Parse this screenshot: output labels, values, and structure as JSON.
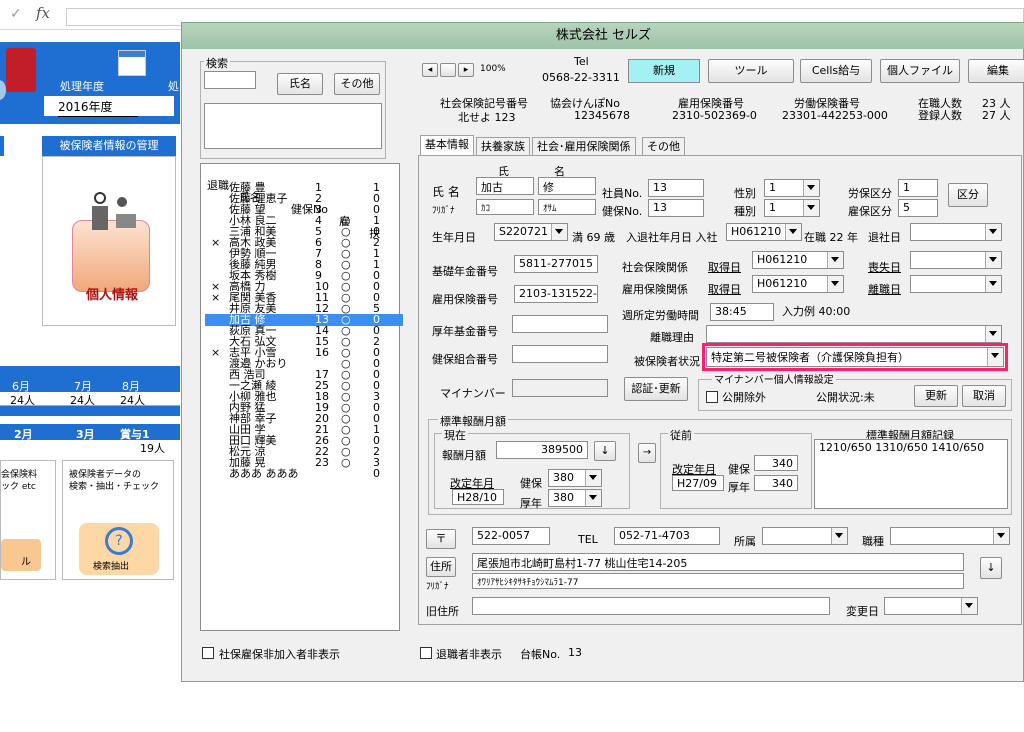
{
  "formula_bar": {
    "check": "✓",
    "fx": "fx"
  },
  "background": {
    "header_year_label": "処理年度",
    "header_year_label2": "処",
    "year": "2016年度",
    "insured_section": "被保険者情報の管理",
    "personal_info_btn": "個人情報",
    "month_headers": [
      "6月",
      "7月",
      "8月"
    ],
    "month_values": [
      "24人",
      "24人",
      "24人"
    ],
    "month2_headers": [
      "2月",
      "3月",
      "賞与1"
    ],
    "month2_values": [
      "",
      "",
      "19人"
    ],
    "box1_text": "会保険料\nック etc",
    "box2_text": "被保険者データの\n検索・抽出・チェック",
    "search_extract": "検索抽出",
    "box1_btn": "ル"
  },
  "window": {
    "title": "株式会社 セルズ"
  },
  "search": {
    "legend": "検索",
    "name_btn": "氏名",
    "other_btn": "その他"
  },
  "list": {
    "headers": [
      "退職",
      "氏名",
      "健保No",
      "雇",
      "扶"
    ],
    "rows": [
      {
        "ret": "",
        "name": "佐藤 豊",
        "no": "1",
        "emp": "",
        "dep": "1"
      },
      {
        "ret": "",
        "name": "佐藤 理恵子",
        "no": "2",
        "emp": "",
        "dep": "0"
      },
      {
        "ret": "",
        "name": "佐藤 望",
        "no": "3",
        "emp": "",
        "dep": "0"
      },
      {
        "ret": "",
        "name": "小林 良二",
        "no": "4",
        "emp": "○",
        "dep": "1"
      },
      {
        "ret": "",
        "name": "三浦 和美",
        "no": "5",
        "emp": "○",
        "dep": "0"
      },
      {
        "ret": "×",
        "name": "高木 政美",
        "no": "6",
        "emp": "○",
        "dep": "2"
      },
      {
        "ret": "",
        "name": "伊勢 順一",
        "no": "7",
        "emp": "○",
        "dep": "1"
      },
      {
        "ret": "",
        "name": "後藤 純男",
        "no": "8",
        "emp": "○",
        "dep": "1"
      },
      {
        "ret": "",
        "name": "坂本 秀樹",
        "no": "9",
        "emp": "○",
        "dep": "0"
      },
      {
        "ret": "×",
        "name": "高橋 力",
        "no": "10",
        "emp": "○",
        "dep": "0"
      },
      {
        "ret": "×",
        "name": "尾関 美香",
        "no": "11",
        "emp": "○",
        "dep": "0"
      },
      {
        "ret": "",
        "name": "井原 友美",
        "no": "12",
        "emp": "○",
        "dep": "5"
      },
      {
        "ret": "",
        "name": "加古 修",
        "no": "13",
        "emp": "○",
        "dep": "0"
      },
      {
        "ret": "",
        "name": "荻原 真一",
        "no": "14",
        "emp": "○",
        "dep": "0"
      },
      {
        "ret": "",
        "name": "大石 弘文",
        "no": "15",
        "emp": "○",
        "dep": "2"
      },
      {
        "ret": "×",
        "name": "志平 小雪",
        "no": "16",
        "emp": "○",
        "dep": "0"
      },
      {
        "ret": "",
        "name": "渡邉 かおり",
        "no": "",
        "emp": "○",
        "dep": "0"
      },
      {
        "ret": "",
        "name": "西 浩司",
        "no": "17",
        "emp": "○",
        "dep": "0"
      },
      {
        "ret": "",
        "name": "一之瀬 綾",
        "no": "25",
        "emp": "○",
        "dep": "0"
      },
      {
        "ret": "",
        "name": "小柳 雅也",
        "no": "18",
        "emp": "○",
        "dep": "3"
      },
      {
        "ret": "",
        "name": "内野 猛",
        "no": "19",
        "emp": "○",
        "dep": "0"
      },
      {
        "ret": "",
        "name": "神部 幸子",
        "no": "20",
        "emp": "○",
        "dep": "0"
      },
      {
        "ret": "",
        "name": "山田 学",
        "no": "21",
        "emp": "○",
        "dep": "1"
      },
      {
        "ret": "",
        "name": "田口 輝美",
        "no": "26",
        "emp": "○",
        "dep": "0"
      },
      {
        "ret": "",
        "name": "松元 涼",
        "no": "22",
        "emp": "○",
        "dep": "2"
      },
      {
        "ret": "",
        "name": "加藤 晃",
        "no": "23",
        "emp": "○",
        "dep": "3"
      },
      {
        "ret": "",
        "name": "あああ あああ",
        "no": "",
        "emp": "",
        "dep": "0"
      }
    ],
    "selected_index": 12,
    "hide_unenrolled": "社保雇保非加入者非表示"
  },
  "toolbar": {
    "zoom": "100%",
    "tel_label": "Tel",
    "tel_number": "0568-22-3311",
    "new_btn": "新規",
    "tool_btn": "ツール",
    "cells_btn": "Cells給与",
    "personal_file_btn": "個人ファイル",
    "edit_btn": "編集"
  },
  "company": {
    "ss_code_label": "社会保険記号番号",
    "ss_code": "北せよ 123",
    "kyokai_label": "協会けんぽNo",
    "kyokai_no": "12345678",
    "emp_ins_label": "雇用保険番号",
    "emp_ins_no": "2310-502369-0",
    "labor_label": "労働保険番号",
    "labor_no": "23301-442253-000",
    "enrolled_label": "在職人数",
    "enrolled_value": "23 人",
    "registered_label": "登録人数",
    "registered_value": "27 人"
  },
  "tabs": [
    "基本情報",
    "扶養家族",
    "社会･雇用保険関係",
    "その他"
  ],
  "basic": {
    "family_label": "氏",
    "given_label": "名",
    "name_label": "氏 名",
    "family": "加古",
    "given": "修",
    "kana_label": "ﾌﾘｶﾞﾅ",
    "family_kana": "ｶｺ",
    "given_kana": "ｵｻﾑ",
    "emp_no_label": "社員No.",
    "emp_no": "13",
    "kenpo_no_label": "健保No.",
    "kenpo_no": "13",
    "sex_label": "性別",
    "sex": "1",
    "kind_label": "種別",
    "kind": "1",
    "labor_cat_label": "労保区分",
    "labor_cat": "1",
    "emp_cat_label": "雇保区分",
    "emp_cat": "5",
    "kubun_btn": "区分",
    "birth_label": "生年月日",
    "birth": "S220721",
    "age": "満 69 歳",
    "join_label": "入退社年月日 入社",
    "join": "H061210",
    "tenure": "在職 22 年",
    "leave_label": "退社日",
    "leave": "",
    "pension_label": "基礎年金番号",
    "pension": "5811-277015",
    "ss_rel_label": "社会保険関係",
    "acquired_label": "取得日",
    "acquired": "H061210",
    "lost_label": "喪失日",
    "lost": "",
    "emp_ins_num_label": "雇用保険番号",
    "emp_ins_num": "2103-131522-5",
    "emp_rel_label": "雇用保険関係",
    "emp_acquired_label": "取得日",
    "emp_acquired": "H061210",
    "resign_label": "離職日",
    "resign": "",
    "hours_label": "週所定労働時間",
    "hours": "38:45",
    "hours_example": "入力例 40:00",
    "fund_label": "厚年基金番号",
    "fund": "",
    "reason_label": "離職理由",
    "reason": "",
    "union_label": "健保組合番号",
    "union": "",
    "status_label": "被保険者状況",
    "status": "特定第二号被保険者（介護保険負担有）",
    "mynumber_label": "マイナンバー",
    "mynumber": "",
    "auth_btn": "認証･更新",
    "mynum_group": "マイナンバー個人情報設定",
    "public_exclude": "公開除外",
    "public_status": "公開状況:未",
    "update_btn": "更新",
    "cancel_btn": "取消"
  },
  "salary": {
    "legend": "標準報酬月額",
    "current_legend": "現在",
    "monthly_label": "報酬月額",
    "monthly": "389500",
    "down_arrow": "↓",
    "right_arrow": "→",
    "revision_label": "改定年月",
    "revision": "H28/10",
    "kenpo_label": "健保",
    "kenpo": "380",
    "kounen_label": "厚年",
    "kounen": "380",
    "prev_legend": "従前",
    "prev_revision_label": "改定年月",
    "prev_revision": "H27/09",
    "prev_kenpo_label": "健保",
    "prev_kenpo": "340",
    "prev_kounen_label": "厚年",
    "prev_kounen": "340",
    "record_label": "標準報酬月額記録",
    "record": "1210/650 1310/650 1410/650"
  },
  "address": {
    "postal_btn": "〒",
    "postal": "522-0057",
    "tel_label": "TEL",
    "tel": "052-71-4703",
    "dept_label": "所属",
    "dept": "",
    "job_label": "職種",
    "job": "",
    "addr_btn": "住所",
    "addr": "尾張旭市北崎町島村1-77 桃山住宅14-205",
    "kana_label": "ﾌﾘｶﾞﾅ",
    "addr_kana": "ｵﾜﾘｱｻﾋｼｷﾀｻｷﾁｮｳｼﾏﾑﾗ1-77",
    "down_btn": "↓",
    "old_label": "旧住所",
    "old": "",
    "change_label": "変更日",
    "change": ""
  },
  "footer": {
    "hide_retired": "退職者非表示",
    "ledger_label": "台帳No.",
    "ledger": "13"
  },
  "colors": {
    "highlight": "#ff1f6a",
    "title_bar": "#9dc3a7",
    "selected_row": "#3c8ff0",
    "sheet_blue": "#1e6fd1"
  }
}
